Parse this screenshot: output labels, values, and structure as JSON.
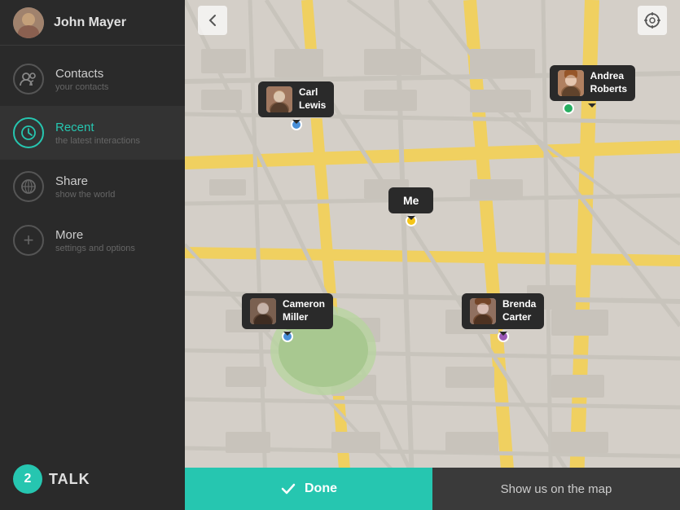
{
  "sidebar": {
    "user": {
      "name_prefix": "John ",
      "name_bold": "Mayer"
    },
    "nav_items": [
      {
        "id": "contacts",
        "label": "Contacts",
        "sublabel": "your contacts",
        "icon": "👥",
        "active": false
      },
      {
        "id": "recent",
        "label": "Recent",
        "sublabel": "the latest interactions",
        "icon": "🕐",
        "active": true
      },
      {
        "id": "share",
        "label": "Share",
        "sublabel": "show the world",
        "icon": "🌍",
        "active": false
      },
      {
        "id": "more",
        "label": "More",
        "sublabel": "settings and options",
        "icon": "+",
        "active": false
      }
    ],
    "brand_label": "TALK"
  },
  "map": {
    "back_button": "‹",
    "locate_button": "⊕",
    "markers": [
      {
        "id": "carl",
        "name_line1": "Carl",
        "name_line2": "Lewis",
        "pin_color": "blue"
      },
      {
        "id": "andrea",
        "name_line1": "Andrea",
        "name_line2": "Roberts",
        "pin_color": "green"
      },
      {
        "id": "cameron",
        "name_line1": "Cameron",
        "name_line2": "Miller",
        "pin_color": "blue"
      },
      {
        "id": "brenda",
        "name_line1": "Brenda",
        "name_line2": "Carter",
        "pin_color": "purple"
      },
      {
        "id": "me",
        "name": "Me",
        "pin_color": "yellow"
      }
    ]
  },
  "bottom_bar": {
    "done_label": "Done",
    "show_map_label": "Show us on the map"
  }
}
